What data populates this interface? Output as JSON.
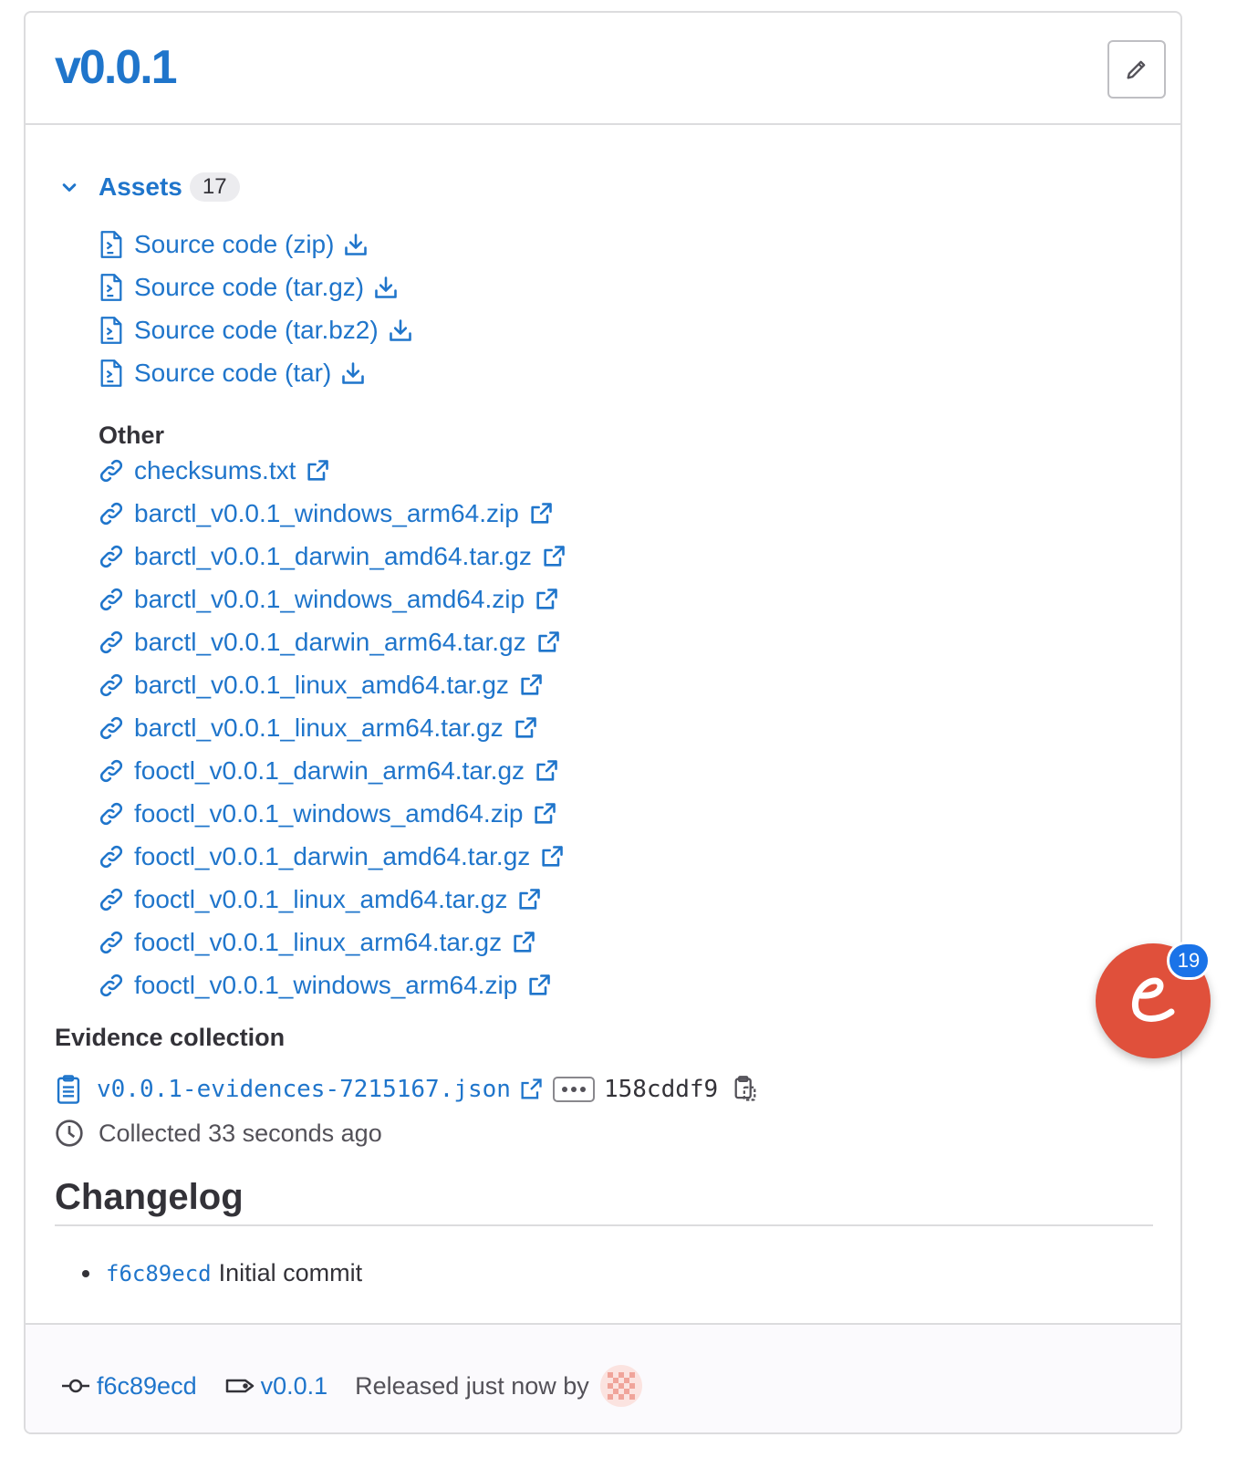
{
  "release": {
    "title": "v0.0.1"
  },
  "assets": {
    "label": "Assets",
    "count": "17",
    "source_code": [
      {
        "label": "Source code (zip)"
      },
      {
        "label": "Source code (tar.gz)"
      },
      {
        "label": "Source code (tar.bz2)"
      },
      {
        "label": "Source code (tar)"
      }
    ],
    "other_heading": "Other",
    "other": [
      {
        "label": "checksums.txt"
      },
      {
        "label": "barctl_v0.0.1_windows_arm64.zip"
      },
      {
        "label": "barctl_v0.0.1_darwin_amd64.tar.gz"
      },
      {
        "label": "barctl_v0.0.1_windows_amd64.zip"
      },
      {
        "label": "barctl_v0.0.1_darwin_arm64.tar.gz"
      },
      {
        "label": "barctl_v0.0.1_linux_amd64.tar.gz"
      },
      {
        "label": "barctl_v0.0.1_linux_arm64.tar.gz"
      },
      {
        "label": "fooctl_v0.0.1_darwin_arm64.tar.gz"
      },
      {
        "label": "fooctl_v0.0.1_windows_amd64.zip"
      },
      {
        "label": "fooctl_v0.0.1_darwin_amd64.tar.gz"
      },
      {
        "label": "fooctl_v0.0.1_linux_amd64.tar.gz"
      },
      {
        "label": "fooctl_v0.0.1_linux_arm64.tar.gz"
      },
      {
        "label": "fooctl_v0.0.1_windows_arm64.zip"
      }
    ]
  },
  "evidence": {
    "heading": "Evidence collection",
    "file": "v0.0.1-evidences-7215167.json",
    "sha": "158cddf9",
    "collected": "Collected 33 seconds ago"
  },
  "changelog": {
    "title": "Changelog",
    "items": [
      {
        "commit": "f6c89ecd",
        "message": "Initial commit"
      }
    ]
  },
  "footer": {
    "commit": "f6c89ecd",
    "tag": "v0.0.1",
    "released": "Released just now by"
  },
  "widget": {
    "badge_count": "19"
  },
  "colors": {
    "link": "#1f75cb",
    "text": "#333238",
    "border": "#dcdcde",
    "widget": "#e0503b",
    "badge": "#1a73e8"
  }
}
